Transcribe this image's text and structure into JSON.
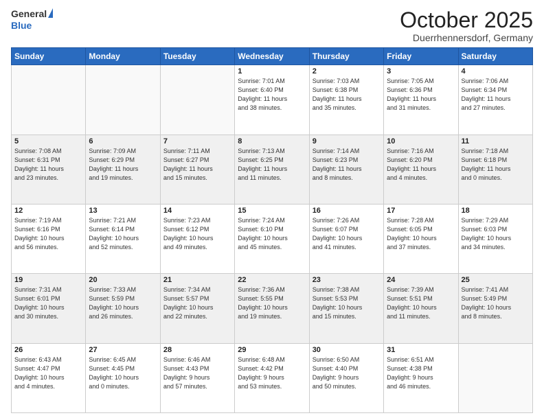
{
  "header": {
    "logo_general": "General",
    "logo_blue": "Blue",
    "month": "October 2025",
    "location": "Duerrhennersdorf, Germany"
  },
  "days_of_week": [
    "Sunday",
    "Monday",
    "Tuesday",
    "Wednesday",
    "Thursday",
    "Friday",
    "Saturday"
  ],
  "weeks": [
    [
      {
        "day": "",
        "info": ""
      },
      {
        "day": "",
        "info": ""
      },
      {
        "day": "",
        "info": ""
      },
      {
        "day": "1",
        "info": "Sunrise: 7:01 AM\nSunset: 6:40 PM\nDaylight: 11 hours\nand 38 minutes."
      },
      {
        "day": "2",
        "info": "Sunrise: 7:03 AM\nSunset: 6:38 PM\nDaylight: 11 hours\nand 35 minutes."
      },
      {
        "day": "3",
        "info": "Sunrise: 7:05 AM\nSunset: 6:36 PM\nDaylight: 11 hours\nand 31 minutes."
      },
      {
        "day": "4",
        "info": "Sunrise: 7:06 AM\nSunset: 6:34 PM\nDaylight: 11 hours\nand 27 minutes."
      }
    ],
    [
      {
        "day": "5",
        "info": "Sunrise: 7:08 AM\nSunset: 6:31 PM\nDaylight: 11 hours\nand 23 minutes."
      },
      {
        "day": "6",
        "info": "Sunrise: 7:09 AM\nSunset: 6:29 PM\nDaylight: 11 hours\nand 19 minutes."
      },
      {
        "day": "7",
        "info": "Sunrise: 7:11 AM\nSunset: 6:27 PM\nDaylight: 11 hours\nand 15 minutes."
      },
      {
        "day": "8",
        "info": "Sunrise: 7:13 AM\nSunset: 6:25 PM\nDaylight: 11 hours\nand 11 minutes."
      },
      {
        "day": "9",
        "info": "Sunrise: 7:14 AM\nSunset: 6:23 PM\nDaylight: 11 hours\nand 8 minutes."
      },
      {
        "day": "10",
        "info": "Sunrise: 7:16 AM\nSunset: 6:20 PM\nDaylight: 11 hours\nand 4 minutes."
      },
      {
        "day": "11",
        "info": "Sunrise: 7:18 AM\nSunset: 6:18 PM\nDaylight: 11 hours\nand 0 minutes."
      }
    ],
    [
      {
        "day": "12",
        "info": "Sunrise: 7:19 AM\nSunset: 6:16 PM\nDaylight: 10 hours\nand 56 minutes."
      },
      {
        "day": "13",
        "info": "Sunrise: 7:21 AM\nSunset: 6:14 PM\nDaylight: 10 hours\nand 52 minutes."
      },
      {
        "day": "14",
        "info": "Sunrise: 7:23 AM\nSunset: 6:12 PM\nDaylight: 10 hours\nand 49 minutes."
      },
      {
        "day": "15",
        "info": "Sunrise: 7:24 AM\nSunset: 6:10 PM\nDaylight: 10 hours\nand 45 minutes."
      },
      {
        "day": "16",
        "info": "Sunrise: 7:26 AM\nSunset: 6:07 PM\nDaylight: 10 hours\nand 41 minutes."
      },
      {
        "day": "17",
        "info": "Sunrise: 7:28 AM\nSunset: 6:05 PM\nDaylight: 10 hours\nand 37 minutes."
      },
      {
        "day": "18",
        "info": "Sunrise: 7:29 AM\nSunset: 6:03 PM\nDaylight: 10 hours\nand 34 minutes."
      }
    ],
    [
      {
        "day": "19",
        "info": "Sunrise: 7:31 AM\nSunset: 6:01 PM\nDaylight: 10 hours\nand 30 minutes."
      },
      {
        "day": "20",
        "info": "Sunrise: 7:33 AM\nSunset: 5:59 PM\nDaylight: 10 hours\nand 26 minutes."
      },
      {
        "day": "21",
        "info": "Sunrise: 7:34 AM\nSunset: 5:57 PM\nDaylight: 10 hours\nand 22 minutes."
      },
      {
        "day": "22",
        "info": "Sunrise: 7:36 AM\nSunset: 5:55 PM\nDaylight: 10 hours\nand 19 minutes."
      },
      {
        "day": "23",
        "info": "Sunrise: 7:38 AM\nSunset: 5:53 PM\nDaylight: 10 hours\nand 15 minutes."
      },
      {
        "day": "24",
        "info": "Sunrise: 7:39 AM\nSunset: 5:51 PM\nDaylight: 10 hours\nand 11 minutes."
      },
      {
        "day": "25",
        "info": "Sunrise: 7:41 AM\nSunset: 5:49 PM\nDaylight: 10 hours\nand 8 minutes."
      }
    ],
    [
      {
        "day": "26",
        "info": "Sunrise: 6:43 AM\nSunset: 4:47 PM\nDaylight: 10 hours\nand 4 minutes."
      },
      {
        "day": "27",
        "info": "Sunrise: 6:45 AM\nSunset: 4:45 PM\nDaylight: 10 hours\nand 0 minutes."
      },
      {
        "day": "28",
        "info": "Sunrise: 6:46 AM\nSunset: 4:43 PM\nDaylight: 9 hours\nand 57 minutes."
      },
      {
        "day": "29",
        "info": "Sunrise: 6:48 AM\nSunset: 4:42 PM\nDaylight: 9 hours\nand 53 minutes."
      },
      {
        "day": "30",
        "info": "Sunrise: 6:50 AM\nSunset: 4:40 PM\nDaylight: 9 hours\nand 50 minutes."
      },
      {
        "day": "31",
        "info": "Sunrise: 6:51 AM\nSunset: 4:38 PM\nDaylight: 9 hours\nand 46 minutes."
      },
      {
        "day": "",
        "info": ""
      }
    ]
  ]
}
